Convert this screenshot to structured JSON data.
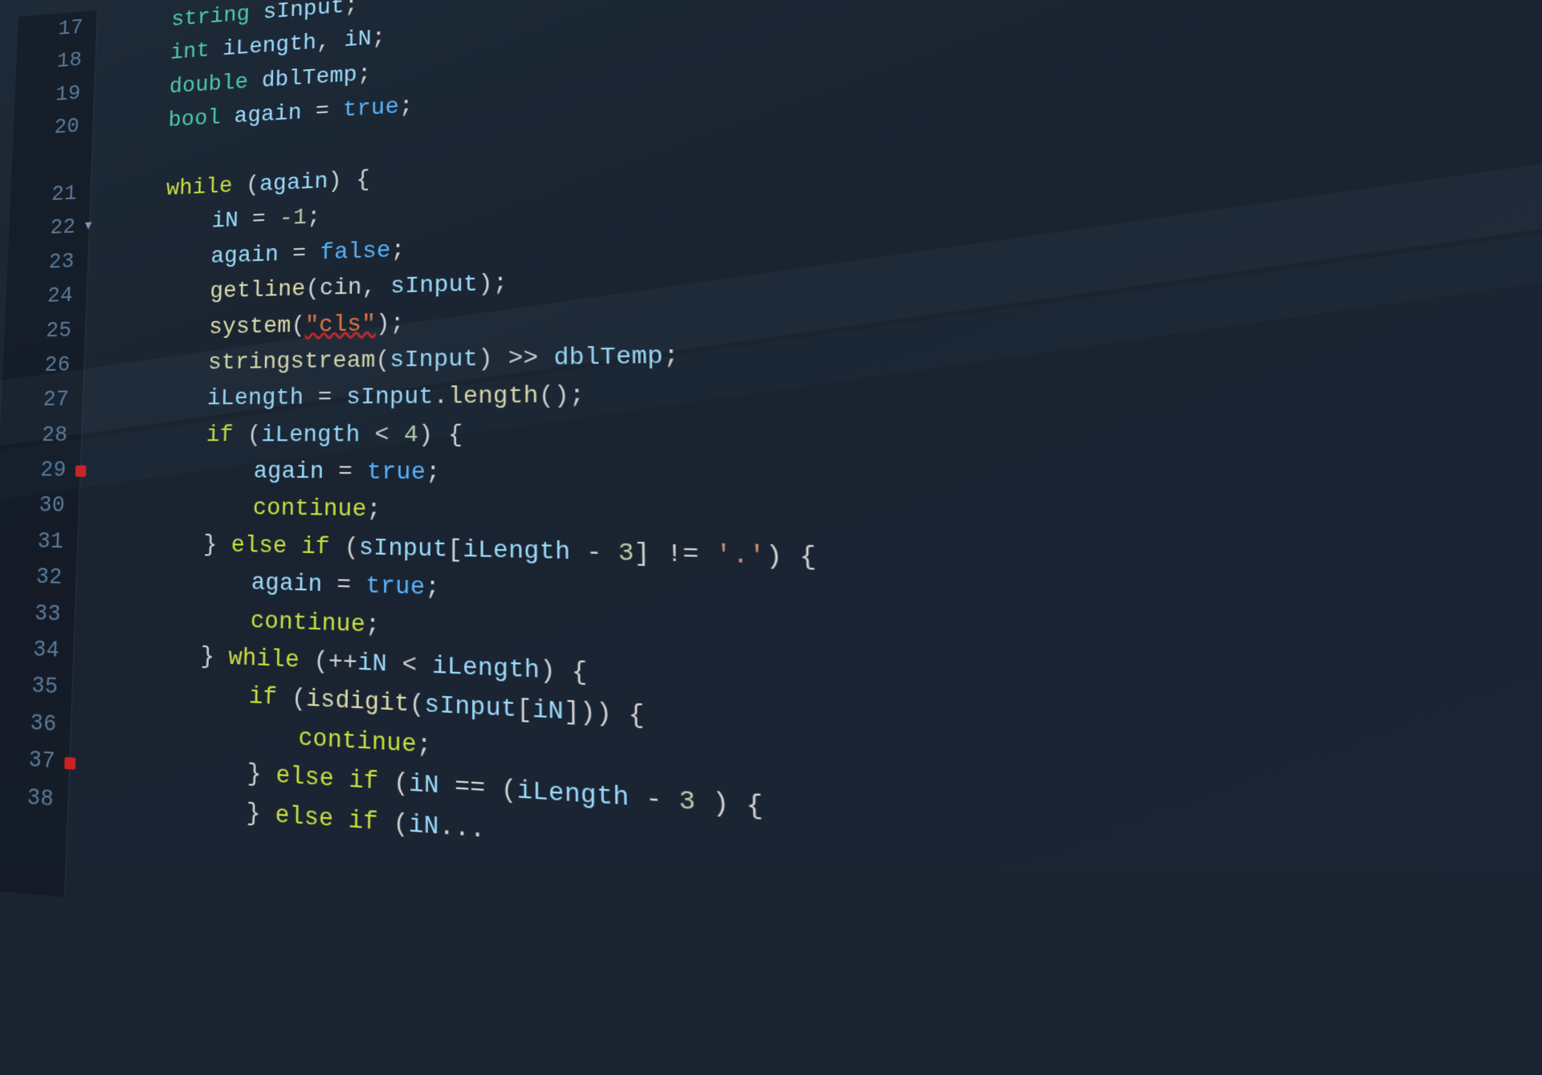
{
  "editor": {
    "theme": {
      "bg": "#1a2330",
      "gutter_bg": "#0f1620",
      "accent_red": "#cc2222",
      "text_default": "#d4d4d4"
    },
    "lines": [
      {
        "num": 17,
        "tokens": [
          {
            "t": "string",
            "c": "kw-type"
          },
          {
            "t": " ",
            "c": "kw-plain"
          },
          {
            "t": "sInput",
            "c": "kw-var"
          },
          {
            "t": ";",
            "c": "kw-plain"
          }
        ],
        "indent": 1,
        "breakpoint": false,
        "foldable": false
      },
      {
        "num": 18,
        "tokens": [
          {
            "t": "int",
            "c": "kw-type"
          },
          {
            "t": " ",
            "c": "kw-plain"
          },
          {
            "t": "iLength",
            "c": "kw-var"
          },
          {
            "t": ", ",
            "c": "kw-plain"
          },
          {
            "t": "iN",
            "c": "kw-var"
          },
          {
            "t": ";",
            "c": "kw-plain"
          }
        ],
        "indent": 1,
        "breakpoint": false,
        "foldable": false
      },
      {
        "num": 19,
        "tokens": [
          {
            "t": "double",
            "c": "kw-type"
          },
          {
            "t": " ",
            "c": "kw-plain"
          },
          {
            "t": "dblTemp",
            "c": "kw-var"
          },
          {
            "t": ";",
            "c": "kw-plain"
          }
        ],
        "indent": 1,
        "breakpoint": false,
        "foldable": false
      },
      {
        "num": 20,
        "tokens": [
          {
            "t": "bool",
            "c": "kw-type"
          },
          {
            "t": " ",
            "c": "kw-plain"
          },
          {
            "t": "again",
            "c": "kw-var"
          },
          {
            "t": " = ",
            "c": "kw-plain"
          },
          {
            "t": "true",
            "c": "kw-bool"
          },
          {
            "t": ";",
            "c": "kw-plain"
          }
        ],
        "indent": 1,
        "breakpoint": false,
        "foldable": false
      },
      {
        "num": "",
        "tokens": [],
        "indent": 0,
        "breakpoint": false,
        "foldable": false
      },
      {
        "num": 21,
        "tokens": [
          {
            "t": "while",
            "c": "kw-ctrl"
          },
          {
            "t": " (",
            "c": "kw-plain"
          },
          {
            "t": "again",
            "c": "kw-var"
          },
          {
            "t": ") {",
            "c": "kw-plain"
          }
        ],
        "indent": 1,
        "breakpoint": false,
        "foldable": false
      },
      {
        "num": 22,
        "tokens": [
          {
            "t": "iN",
            "c": "kw-var"
          },
          {
            "t": " = ",
            "c": "kw-plain"
          },
          {
            "t": "-1",
            "c": "kw-num"
          },
          {
            "t": ";",
            "c": "kw-plain"
          }
        ],
        "indent": 2,
        "breakpoint": false,
        "foldable": true
      },
      {
        "num": 23,
        "tokens": [
          {
            "t": "again",
            "c": "kw-var"
          },
          {
            "t": " = ",
            "c": "kw-plain"
          },
          {
            "t": "false",
            "c": "kw-bool"
          },
          {
            "t": ";",
            "c": "kw-plain"
          }
        ],
        "indent": 2,
        "breakpoint": false,
        "foldable": false
      },
      {
        "num": 24,
        "tokens": [
          {
            "t": "getline",
            "c": "kw-func"
          },
          {
            "t": "(cin, ",
            "c": "kw-plain"
          },
          {
            "t": "sInput",
            "c": "kw-var"
          },
          {
            "t": ");",
            "c": "kw-plain"
          }
        ],
        "indent": 2,
        "breakpoint": false,
        "foldable": false
      },
      {
        "num": 25,
        "tokens": [
          {
            "t": "system",
            "c": "kw-func"
          },
          {
            "t": "(",
            "c": "kw-plain"
          },
          {
            "t": "\"cls\"",
            "c": "kw-squiggle"
          },
          {
            "t": ");",
            "c": "kw-plain"
          }
        ],
        "indent": 2,
        "breakpoint": false,
        "foldable": false
      },
      {
        "num": 26,
        "tokens": [
          {
            "t": "stringstream",
            "c": "kw-func"
          },
          {
            "t": "(",
            "c": "kw-plain"
          },
          {
            "t": "sInput",
            "c": "kw-var"
          },
          {
            "t": ") >> ",
            "c": "kw-plain"
          },
          {
            "t": "dblTemp",
            "c": "kw-var"
          },
          {
            "t": ";",
            "c": "kw-plain"
          }
        ],
        "indent": 2,
        "breakpoint": false,
        "foldable": false
      },
      {
        "num": 27,
        "tokens": [
          {
            "t": "iLength",
            "c": "kw-var"
          },
          {
            "t": " = ",
            "c": "kw-plain"
          },
          {
            "t": "sInput",
            "c": "kw-var"
          },
          {
            "t": ".",
            "c": "kw-plain"
          },
          {
            "t": "length",
            "c": "kw-method"
          },
          {
            "t": "();",
            "c": "kw-plain"
          }
        ],
        "indent": 2,
        "breakpoint": false,
        "foldable": false
      },
      {
        "num": 28,
        "tokens": [
          {
            "t": "if",
            "c": "kw-ctrl"
          },
          {
            "t": " (",
            "c": "kw-plain"
          },
          {
            "t": "iLength",
            "c": "kw-var"
          },
          {
            "t": " < ",
            "c": "kw-plain"
          },
          {
            "t": "4",
            "c": "kw-num"
          },
          {
            "t": ") {",
            "c": "kw-plain"
          }
        ],
        "indent": 2,
        "breakpoint": false,
        "foldable": false
      },
      {
        "num": 29,
        "tokens": [
          {
            "t": "again",
            "c": "kw-var"
          },
          {
            "t": " = ",
            "c": "kw-plain"
          },
          {
            "t": "true",
            "c": "kw-bool"
          },
          {
            "t": ";",
            "c": "kw-plain"
          }
        ],
        "indent": 3,
        "breakpoint": true,
        "foldable": false
      },
      {
        "num": 30,
        "tokens": [
          {
            "t": "continue",
            "c": "kw-ctrl"
          },
          {
            "t": ";",
            "c": "kw-plain"
          }
        ],
        "indent": 3,
        "breakpoint": false,
        "foldable": false
      },
      {
        "num": 31,
        "tokens": [
          {
            "t": "} ",
            "c": "kw-plain"
          },
          {
            "t": "else if",
            "c": "kw-ctrl"
          },
          {
            "t": " (",
            "c": "kw-plain"
          },
          {
            "t": "sInput",
            "c": "kw-var"
          },
          {
            "t": "[",
            "c": "kw-plain"
          },
          {
            "t": "iLength",
            "c": "kw-var"
          },
          {
            "t": " - ",
            "c": "kw-plain"
          },
          {
            "t": "3",
            "c": "kw-num"
          },
          {
            "t": "] != ",
            "c": "kw-plain"
          },
          {
            "t": "'.'",
            "c": "kw-char"
          },
          {
            "t": ") {",
            "c": "kw-plain"
          }
        ],
        "indent": 2,
        "breakpoint": false,
        "foldable": false
      },
      {
        "num": 32,
        "tokens": [
          {
            "t": "again",
            "c": "kw-var"
          },
          {
            "t": " = ",
            "c": "kw-plain"
          },
          {
            "t": "true",
            "c": "kw-bool"
          },
          {
            "t": ";",
            "c": "kw-plain"
          }
        ],
        "indent": 3,
        "breakpoint": false,
        "foldable": false
      },
      {
        "num": 33,
        "tokens": [
          {
            "t": "continue",
            "c": "kw-ctrl"
          },
          {
            "t": ";",
            "c": "kw-plain"
          }
        ],
        "indent": 3,
        "breakpoint": false,
        "foldable": false
      },
      {
        "num": 34,
        "tokens": [
          {
            "t": "} ",
            "c": "kw-plain"
          },
          {
            "t": "while",
            "c": "kw-ctrl"
          },
          {
            "t": " (++",
            "c": "kw-plain"
          },
          {
            "t": "iN",
            "c": "kw-var"
          },
          {
            "t": " < ",
            "c": "kw-plain"
          },
          {
            "t": "iLength",
            "c": "kw-var"
          },
          {
            "t": ") {",
            "c": "kw-plain"
          }
        ],
        "indent": 2,
        "breakpoint": false,
        "foldable": false
      },
      {
        "num": 35,
        "tokens": [
          {
            "t": "if",
            "c": "kw-ctrl"
          },
          {
            "t": " (",
            "c": "kw-plain"
          },
          {
            "t": "isdigit",
            "c": "kw-func"
          },
          {
            "t": "(",
            "c": "kw-plain"
          },
          {
            "t": "sInput",
            "c": "kw-var"
          },
          {
            "t": "[",
            "c": "kw-plain"
          },
          {
            "t": "iN",
            "c": "kw-var"
          },
          {
            "t": "]))",
            "c": "kw-plain"
          },
          {
            "t": " {",
            "c": "kw-plain"
          }
        ],
        "indent": 3,
        "breakpoint": false,
        "foldable": false
      },
      {
        "num": 36,
        "tokens": [
          {
            "t": "continue",
            "c": "kw-ctrl"
          },
          {
            "t": ";",
            "c": "kw-plain"
          }
        ],
        "indent": 4,
        "breakpoint": false,
        "foldable": false
      },
      {
        "num": 37,
        "tokens": [
          {
            "t": "} ",
            "c": "kw-plain"
          },
          {
            "t": "else if",
            "c": "kw-ctrl"
          },
          {
            "t": " (",
            "c": "kw-plain"
          },
          {
            "t": "iN",
            "c": "kw-var"
          },
          {
            "t": " == (",
            "c": "kw-plain"
          },
          {
            "t": "iLength",
            "c": "kw-var"
          },
          {
            "t": " - ",
            "c": "kw-plain"
          },
          {
            "t": "3",
            "c": "kw-num"
          },
          {
            "t": " ) {",
            "c": "kw-plain"
          }
        ],
        "indent": 3,
        "breakpoint": true,
        "foldable": false
      },
      {
        "num": 38,
        "tokens": [
          {
            "t": "} ",
            "c": "kw-plain"
          },
          {
            "t": "else if",
            "c": "kw-ctrl"
          },
          {
            "t": " (",
            "c": "kw-plain"
          },
          {
            "t": "iN",
            "c": "kw-var"
          },
          {
            "t": "...",
            "c": "kw-plain"
          }
        ],
        "indent": 3,
        "breakpoint": false,
        "foldable": false
      }
    ]
  }
}
